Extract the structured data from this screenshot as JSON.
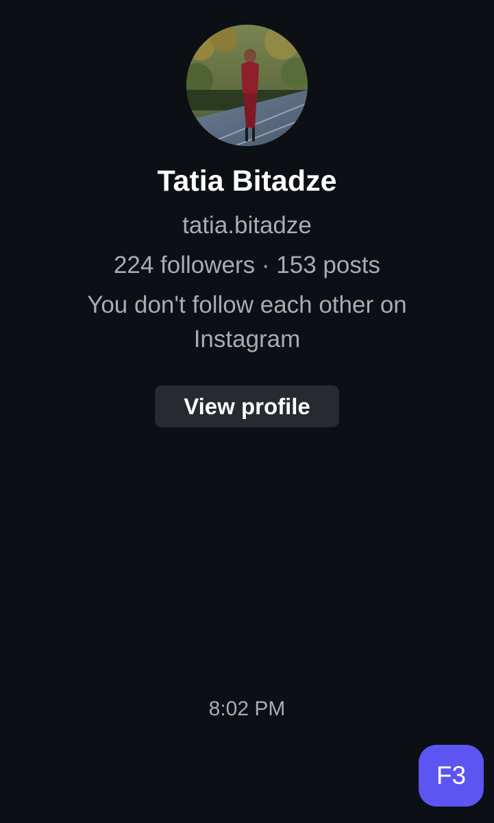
{
  "profile": {
    "name": "Tatia Bitadze",
    "username": "tatia.bitadze",
    "stats": "224 followers · 153 posts",
    "mutual_text": "You don't follow each other on Instagram",
    "view_profile_label": "View profile"
  },
  "message": {
    "timestamp": "8:02 PM"
  },
  "fab": {
    "label": "F3"
  },
  "colors": {
    "background": "#0c0f14",
    "secondary_text": "#a8acb3",
    "button_bg": "#272a30",
    "fab_bg": "#5c55f2"
  }
}
